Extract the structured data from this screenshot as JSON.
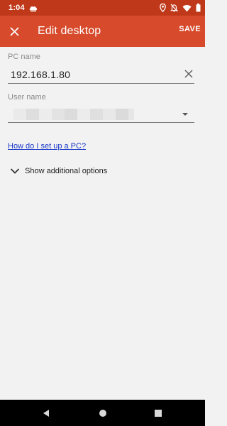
{
  "status_bar": {
    "time": "1:04",
    "icons": [
      "cloud-icon",
      "location-icon",
      "notifications-off-icon",
      "wifi-icon",
      "battery-icon"
    ]
  },
  "app_bar": {
    "title": "Edit desktop",
    "save_label": "SAVE",
    "close_icon": "close-icon"
  },
  "form": {
    "pc_name": {
      "label": "PC name",
      "value": "192.168.1.80"
    },
    "user_name": {
      "label": "User name"
    },
    "help_link": "How do I set up a PC?",
    "additional_options": "Show additional options"
  },
  "colors": {
    "status_bar": "#c0381a",
    "app_bar": "#d74a2b",
    "background": "#f2f2f2",
    "link": "#1a39c9"
  }
}
